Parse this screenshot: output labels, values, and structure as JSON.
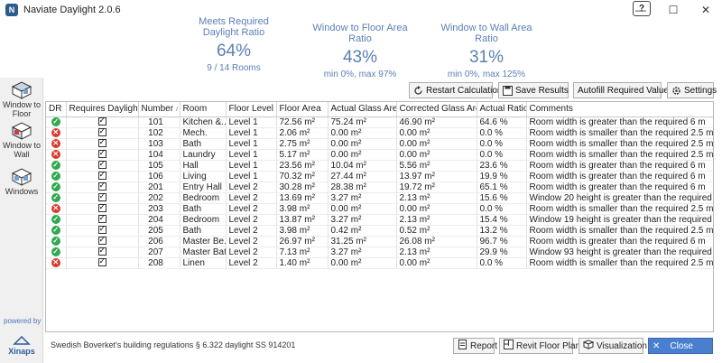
{
  "window": {
    "title": "Naviate Daylight 2.0.6",
    "help": "?",
    "minimize": "—",
    "maximize": "☐",
    "close": "✕"
  },
  "metrics": [
    {
      "label": "Meets Required Daylight Ratio",
      "value": "64%",
      "sub": "9 / 14 Rooms"
    },
    {
      "label": "Window to Floor Area Ratio",
      "value": "43%",
      "sub": "min 0%, max 97%"
    },
    {
      "label": "Window to Wall Area Ratio",
      "value": "31%",
      "sub": "min 0%, max 125%"
    }
  ],
  "sidebar": {
    "items": [
      {
        "label": "Window to Floor",
        "icon": "window-to-floor-icon"
      },
      {
        "label": "Window to Wall",
        "icon": "window-to-wall-icon"
      },
      {
        "label": "Windows",
        "icon": "windows-icon"
      }
    ],
    "powered_by": "powered by",
    "brand": "Xinaps"
  },
  "toolbar": {
    "restart": "Restart Calculation",
    "save": "Save Results",
    "autofill": "Autofill Required Values",
    "settings": "Settings"
  },
  "table": {
    "columns": [
      "DR",
      "Requires Daylight",
      "Number",
      "Room",
      "Floor Level",
      "Floor Area",
      "Actual Glass Area",
      "Corrected Glass Area",
      "Actual Ratio",
      "Comments"
    ],
    "rows": [
      {
        "status": "ok",
        "requires": true,
        "number": "101",
        "room": "Kitchen &...",
        "level": "Level 1",
        "floor_area": "72.56 m²",
        "glass": "75.24 m²",
        "corrected": "46.90 m²",
        "ratio": "64.6 %",
        "comment": "Room width is greater than the required 6 m"
      },
      {
        "status": "bad",
        "requires": true,
        "number": "102",
        "room": "Mech.",
        "level": "Level 1",
        "floor_area": "2.06 m²",
        "glass": "0.00 m²",
        "corrected": "0.00 m²",
        "ratio": "0.0 %",
        "comment": "Room width is smaller than the required 2.5 m"
      },
      {
        "status": "bad",
        "requires": true,
        "number": "103",
        "room": "Bath",
        "level": "Level 1",
        "floor_area": "2.75 m²",
        "glass": "0.00 m²",
        "corrected": "0.00 m²",
        "ratio": "0.0 %",
        "comment": "Room width is smaller than the required 2.5 m"
      },
      {
        "status": "bad",
        "requires": true,
        "number": "104",
        "room": "Laundry",
        "level": "Level 1",
        "floor_area": "5.17 m²",
        "glass": "0.00 m²",
        "corrected": "0.00 m²",
        "ratio": "0.0 %",
        "comment": "Room width is smaller than the required 2.5 m"
      },
      {
        "status": "ok",
        "requires": true,
        "number": "105",
        "room": "Hall",
        "level": "Level 1",
        "floor_area": "23.56 m²",
        "glass": "10.04 m²",
        "corrected": "5.56 m²",
        "ratio": "23.6 %",
        "comment": "Room width is greater than the required 6 m"
      },
      {
        "status": "ok",
        "requires": true,
        "number": "106",
        "room": "Living",
        "level": "Level 1",
        "floor_area": "70.32 m²",
        "glass": "27.44 m²",
        "corrected": "13.97 m²",
        "ratio": "19.9 %",
        "comment": "Room width is greater than the required 6 m"
      },
      {
        "status": "ok",
        "requires": true,
        "number": "201",
        "room": "Entry Hall",
        "level": "Level 2",
        "floor_area": "30.28 m²",
        "glass": "28.38 m²",
        "corrected": "19.72 m²",
        "ratio": "65.1 %",
        "comment": "Room width is greater than the required 6 m"
      },
      {
        "status": "ok",
        "requires": true,
        "number": "202",
        "room": "Bedroom",
        "level": "Level 2",
        "floor_area": "13.69 m²",
        "glass": "3.27 m²",
        "corrected": "2.13 m²",
        "ratio": "15.6 %",
        "comment": "Window 20 height is greater than the required 1.4 m"
      },
      {
        "status": "bad",
        "requires": true,
        "number": "203",
        "room": "Bath",
        "level": "Level 2",
        "floor_area": "3.98 m²",
        "glass": "0.00 m²",
        "corrected": "0.00 m²",
        "ratio": "0.0 %",
        "comment": "Room width is smaller than the required 2.5 m"
      },
      {
        "status": "ok",
        "requires": true,
        "number": "204",
        "room": "Bedroom",
        "level": "Level 2",
        "floor_area": "13.87 m²",
        "glass": "3.27 m²",
        "corrected": "2.13 m²",
        "ratio": "15.4 %",
        "comment": "Window 19 height is greater than the required 1.4 m"
      },
      {
        "status": "ok",
        "requires": true,
        "number": "205",
        "room": "Bath",
        "level": "Level 2",
        "floor_area": "3.98 m²",
        "glass": "0.42 m²",
        "corrected": "0.52 m²",
        "ratio": "13.2 %",
        "comment": "Room width is smaller than the required 2.5 m"
      },
      {
        "status": "ok",
        "requires": true,
        "number": "206",
        "room": "Master Be...",
        "level": "Level 2",
        "floor_area": "26.97 m²",
        "glass": "31.25 m²",
        "corrected": "26.08 m²",
        "ratio": "96.7 %",
        "comment": "Room width is greater than the required 6 m"
      },
      {
        "status": "ok",
        "requires": true,
        "number": "207",
        "room": "Master Bath",
        "level": "Level 2",
        "floor_area": "7.13 m²",
        "glass": "3.27 m²",
        "corrected": "2.13 m²",
        "ratio": "29.9 %",
        "comment": "Window 93 height is greater than the required 1.4 m"
      },
      {
        "status": "bad",
        "requires": true,
        "number": "208",
        "room": "Linen",
        "level": "Level 2",
        "floor_area": "1.40 m²",
        "glass": "0.00 m²",
        "corrected": "0.00 m²",
        "ratio": "0.0 %",
        "comment": "Room width is smaller than the required 2.5 m"
      }
    ]
  },
  "footer": {
    "regulation": "Swedish Boverket's building regulations § 6.322 daylight SS 914201",
    "report": "Report",
    "floor_plan": "Revit Floor Plan",
    "visualization": "Visualization",
    "close": "Close"
  },
  "colors": {
    "accent": "#5b7fb7",
    "ok": "#2fa84f",
    "bad": "#d93a2e",
    "close_button": "#4a7fd0"
  }
}
